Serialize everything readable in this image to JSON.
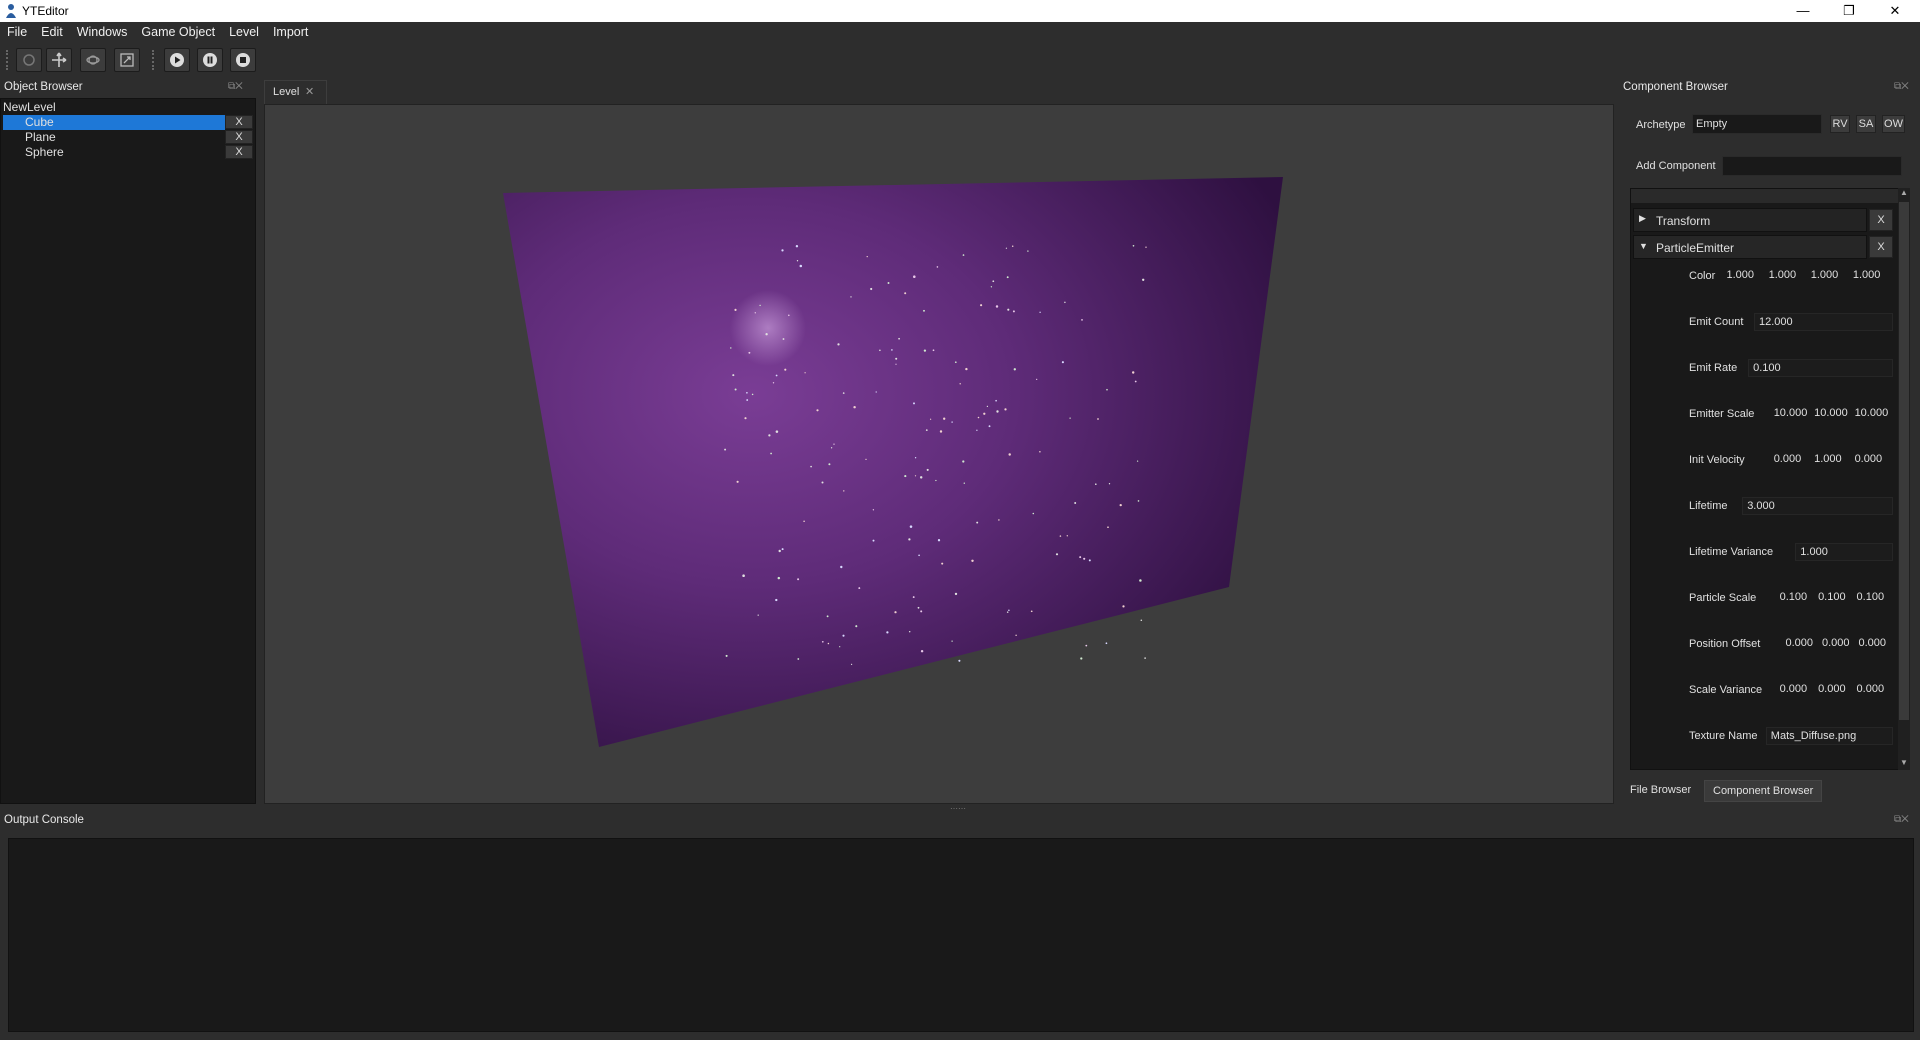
{
  "window": {
    "title": "YTEditor",
    "minimize": "—",
    "maximize": "❐",
    "close": "✕"
  },
  "menu": [
    "File",
    "Edit",
    "Windows",
    "Game Object",
    "Level",
    "Import"
  ],
  "toolbar": {
    "icons": [
      "circle-tool-icon",
      "move-tool-icon",
      "rotate-tool-icon",
      "scale-tool-icon",
      "play-icon",
      "pause-icon",
      "stop-icon"
    ]
  },
  "object_browser": {
    "title": "Object Browser",
    "root": "NewLevel",
    "items": [
      {
        "label": "Cube",
        "delete": "X",
        "selected": true
      },
      {
        "label": "Plane",
        "delete": "X",
        "selected": false
      },
      {
        "label": "Sphere",
        "delete": "X",
        "selected": false
      }
    ]
  },
  "viewport": {
    "tab_label": "Level",
    "tab_close": "✕"
  },
  "component_browser": {
    "title": "Component Browser",
    "archetype_label": "Archetype",
    "archetype_value": "Empty",
    "buttons": [
      "RV",
      "SA",
      "OW"
    ],
    "add_component_label": "Add Component",
    "add_component_value": "",
    "components": [
      {
        "name": "Transform",
        "remove": "X",
        "expanded": false
      },
      {
        "name": "ParticleEmitter",
        "remove": "X",
        "expanded": true
      }
    ],
    "properties": [
      {
        "label": "Color",
        "values": [
          "1.000",
          "1.000",
          "1.000",
          "1.000"
        ]
      },
      {
        "label": "Emit Count",
        "values": [
          "12.000"
        ]
      },
      {
        "label": "Emit Rate",
        "values": [
          "0.100"
        ]
      },
      {
        "label": "Emitter Scale",
        "values": [
          "10.000",
          "10.000",
          "10.000"
        ]
      },
      {
        "label": "Init Velocity",
        "values": [
          "0.000",
          "1.000",
          "0.000"
        ]
      },
      {
        "label": "Lifetime",
        "values": [
          "3.000"
        ]
      },
      {
        "label": "Lifetime Variance",
        "values": [
          "1.000"
        ]
      },
      {
        "label": "Particle Scale",
        "values": [
          "0.100",
          "0.100",
          "0.100"
        ]
      },
      {
        "label": "Position Offset",
        "values": [
          "0.000",
          "0.000",
          "0.000"
        ]
      },
      {
        "label": "Scale Variance",
        "values": [
          "0.000",
          "0.000",
          "0.000"
        ]
      },
      {
        "label": "Texture Name",
        "values": [
          "Mats_Diffuse.png"
        ]
      }
    ],
    "bottom_tabs": [
      "File Browser",
      "Component Browser"
    ]
  },
  "output_console": {
    "title": "Output Console",
    "text": ""
  },
  "colors": {
    "selection": "#1e78d7",
    "plane": "#5a2a72",
    "background": "#2d2d2d"
  }
}
